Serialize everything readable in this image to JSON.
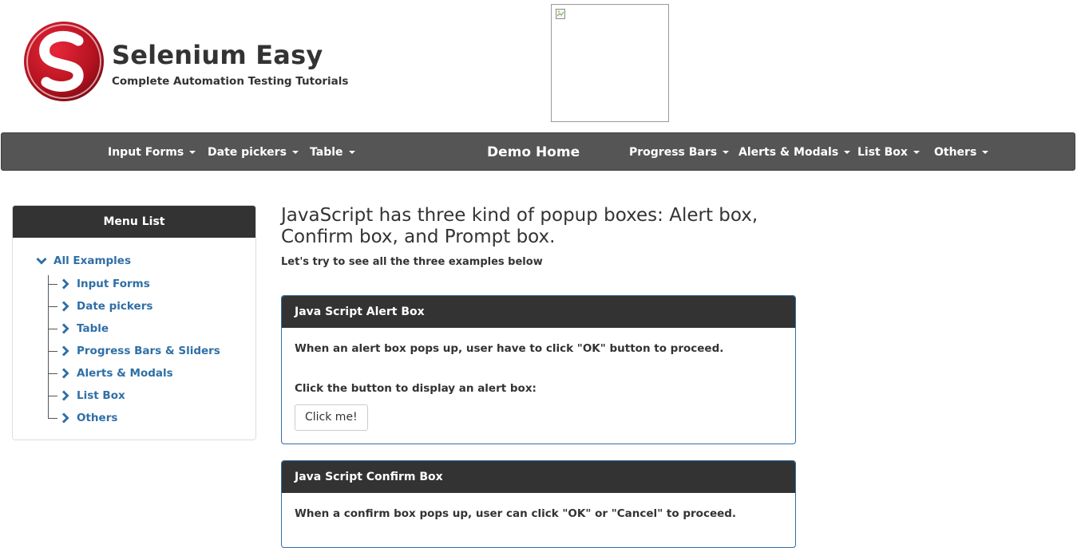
{
  "brand": {
    "title": "Selenium Easy",
    "subtitle": "Complete Automation Testing Tutorials"
  },
  "navbar": {
    "left_items": [
      "Input Forms",
      "Date pickers",
      "Table"
    ],
    "home": "Demo Home",
    "right_items": [
      "Progress Bars",
      "Alerts & Modals",
      "List Box",
      "Others"
    ]
  },
  "sidebar": {
    "title": "Menu List",
    "root": "All Examples",
    "items": [
      "Input Forms",
      "Date pickers",
      "Table",
      "Progress Bars & Sliders",
      "Alerts & Modals",
      "List Box",
      "Others"
    ]
  },
  "main": {
    "title": "JavaScript has three kind of popup boxes: Alert box, Confirm box, and Prompt box.",
    "subtitle": "Let's try to see all the three examples below"
  },
  "alert_panel": {
    "heading": "Java Script Alert Box",
    "description": "When an alert box pops up, user have to click \"OK\" button to proceed.",
    "prompt": "Click the button to display an alert box:",
    "button_label": "Click me!"
  },
  "confirm_panel": {
    "heading": "Java Script Confirm Box",
    "description": "When a confirm box pops up, user can click \"OK\" or \"Cancel\" to proceed."
  },
  "colors": {
    "navbar_bg": "#555555",
    "panel_head_bg": "#333333",
    "link": "#2f6fa6",
    "brand_red": "#c8102e"
  },
  "icons": {
    "logo": "selenium-easy-logo",
    "tree_root": "chevron-down-icon",
    "tree_item": "chevron-right-icon",
    "nav_caret": "caret-down-icon",
    "ad": "broken-image-icon"
  }
}
